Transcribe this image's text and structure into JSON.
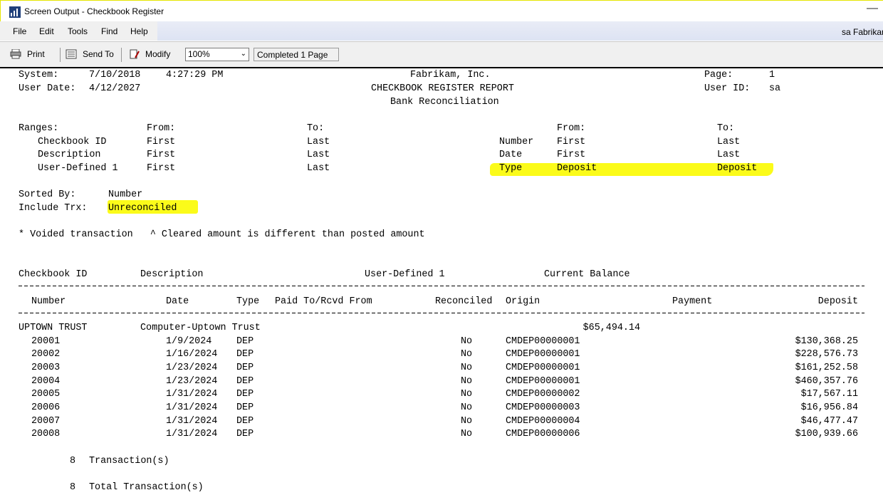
{
  "window": {
    "title": "Screen Output - Checkbook Register"
  },
  "menu": {
    "items": [
      "File",
      "Edit",
      "Tools",
      "Find",
      "Help"
    ],
    "user": "sa  Fabrikam"
  },
  "toolbar": {
    "print": "Print",
    "send_to": "Send To",
    "modify": "Modify",
    "zoom": "100%",
    "status": "Completed 1 Page"
  },
  "report": {
    "header": {
      "system_label": "System:",
      "system_date": "7/10/2018",
      "system_time": "4:27:29 PM",
      "company": "Fabrikam, Inc.",
      "page_label": "Page:",
      "page": "1",
      "user_date_label": "User Date:",
      "user_date": "4/12/2027",
      "report_title": "CHECKBOOK REGISTER REPORT",
      "user_id_label": "User ID:",
      "user_id": "sa",
      "subtitle": "Bank Reconciliation"
    },
    "ranges": {
      "label": "Ranges:",
      "from": "From:",
      "to": "To:",
      "left": [
        {
          "name": "Checkbook ID",
          "from": "First",
          "to": "Last"
        },
        {
          "name": "Description",
          "from": "First",
          "to": "Last"
        },
        {
          "name": "User-Defined 1",
          "from": "First",
          "to": "Last"
        }
      ],
      "right": [
        {
          "name": "Number",
          "from": "First",
          "to": "Last"
        },
        {
          "name": "Date",
          "from": "First",
          "to": "Last"
        },
        {
          "name": "Type",
          "from": "Deposit",
          "to": "Deposit"
        }
      ]
    },
    "sorted_by_label": "Sorted By:",
    "sorted_by": "Number",
    "include_label": "Include Trx:",
    "include": "Unreconciled",
    "legend": "* Voided transaction   ^ Cleared amount is different than posted amount",
    "columns1": {
      "checkbook_id": "Checkbook ID",
      "description": "Description",
      "user_defined": "User-Defined 1",
      "current_balance": "Current Balance"
    },
    "columns2": {
      "number": "Number",
      "date": "Date",
      "type": "Type",
      "paid_to": "Paid To/Rcvd From",
      "reconciled": "Reconciled",
      "origin": "Origin",
      "payment": "Payment",
      "deposit": "Deposit"
    },
    "checkbook": {
      "id": "UPTOWN TRUST",
      "description": "Computer-Uptown Trust",
      "balance": "$65,494.14"
    },
    "rows": [
      {
        "number": "20001",
        "date": "1/9/2024",
        "type": "DEP",
        "reconciled": "No",
        "origin": "CMDEP00000001",
        "deposit": "$130,368.25"
      },
      {
        "number": "20002",
        "date": "1/16/2024",
        "type": "DEP",
        "reconciled": "No",
        "origin": "CMDEP00000001",
        "deposit": "$228,576.73"
      },
      {
        "number": "20003",
        "date": "1/23/2024",
        "type": "DEP",
        "reconciled": "No",
        "origin": "CMDEP00000001",
        "deposit": "$161,252.58"
      },
      {
        "number": "20004",
        "date": "1/23/2024",
        "type": "DEP",
        "reconciled": "No",
        "origin": "CMDEP00000001",
        "deposit": "$460,357.76"
      },
      {
        "number": "20005",
        "date": "1/31/2024",
        "type": "DEP",
        "reconciled": "No",
        "origin": "CMDEP00000002",
        "deposit": "$17,567.11"
      },
      {
        "number": "20006",
        "date": "1/31/2024",
        "type": "DEP",
        "reconciled": "No",
        "origin": "CMDEP00000003",
        "deposit": "$16,956.84"
      },
      {
        "number": "20007",
        "date": "1/31/2024",
        "type": "DEP",
        "reconciled": "No",
        "origin": "CMDEP00000004",
        "deposit": "$46,477.47"
      },
      {
        "number": "20008",
        "date": "1/31/2024",
        "type": "DEP",
        "reconciled": "No",
        "origin": "CMDEP00000006",
        "deposit": "$100,939.66"
      }
    ],
    "trx_count": "8",
    "trx_label": "Transaction(s)",
    "total_count": "8",
    "total_label": "Total Transaction(s)"
  }
}
